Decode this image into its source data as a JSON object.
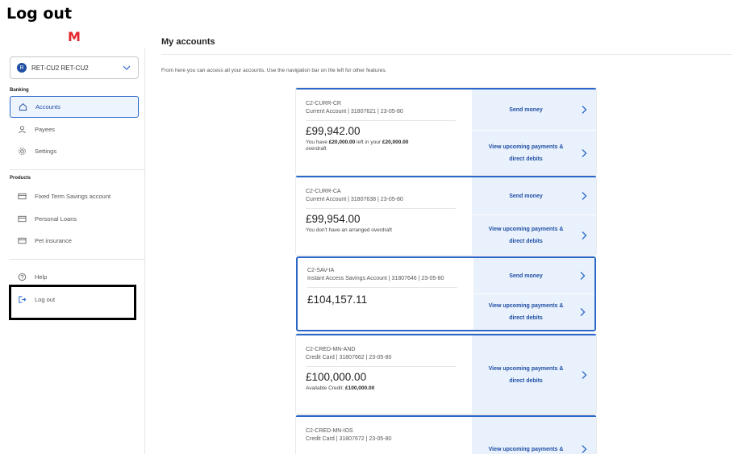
{
  "overlay_label": "Log out",
  "brand": {
    "logo_text": "M",
    "logo_color": "#e3262b"
  },
  "account_selector": {
    "avatar_letter": "R",
    "name": "RET-CU2 RET-CU2"
  },
  "sidebar": {
    "banking_title": "Banking",
    "banking_items": [
      {
        "label": "Accounts",
        "icon": "home-icon",
        "active": true
      },
      {
        "label": "Payees",
        "icon": "person-icon"
      },
      {
        "label": "Settings",
        "icon": "gear-icon"
      }
    ],
    "products_title": "Products",
    "product_items": [
      {
        "label": "Fixed Term Savings account",
        "icon": "card-icon"
      },
      {
        "label": "Personal Loans",
        "icon": "card-icon"
      },
      {
        "label": "Pet insurance",
        "icon": "card-icon"
      }
    ],
    "footer_items": [
      {
        "label": "Help",
        "icon": "help-icon"
      },
      {
        "label": "Log out",
        "icon": "logout-icon"
      }
    ]
  },
  "main": {
    "title": "My accounts",
    "subtitle": "From here you can access all your accounts. Use the navigation bar on the left for other features."
  },
  "accounts": [
    {
      "code": "C2-CURR-CR",
      "details": "Current Account | 31807621 | 23-05-80",
      "balance": "£99,942.00",
      "note_pre": "You have ",
      "note_bold1": "£20,000.00",
      "note_mid": " left in your ",
      "note_bold2": "£20,000.00",
      "note_post": " overdraft",
      "send_money": "Send money",
      "upcoming_line1": "View upcoming payments &",
      "upcoming_line2": "direct debits"
    },
    {
      "code": "C2-CURR-CA",
      "details": "Current Account | 31807638 | 23-05-80",
      "balance": "£99,954.00",
      "note": "You don't have an arranged overdraft",
      "send_money": "Send money",
      "upcoming_line1": "View upcoming payments &",
      "upcoming_line2": "direct debits"
    },
    {
      "code": "C2-SAV-IA",
      "details": "Instant Access Savings Account | 31807646 | 23-05-80",
      "balance": "£104,157.11",
      "send_money": "Send money",
      "upcoming_line1": "View upcoming payments &",
      "upcoming_line2": "direct debits"
    },
    {
      "code": "C2-CRED-MN-AND",
      "details": "Credit Card | 31807662 | 23-05-80",
      "balance": "£100,000.00",
      "note_pre": "Available Credit: ",
      "note_bold1": "£100,000.00",
      "upcoming_line1": "View upcoming payments &",
      "upcoming_line2": "direct debits"
    },
    {
      "code": "C2-CRED-MN-IOS",
      "details": "Credit Card | 31807672 | 23-05-80",
      "upcoming_line1": "View upcoming payments &"
    }
  ],
  "colors": {
    "accent": "#2a67c9",
    "action_bg": "#e9f1fc",
    "highlight": "#000000"
  }
}
